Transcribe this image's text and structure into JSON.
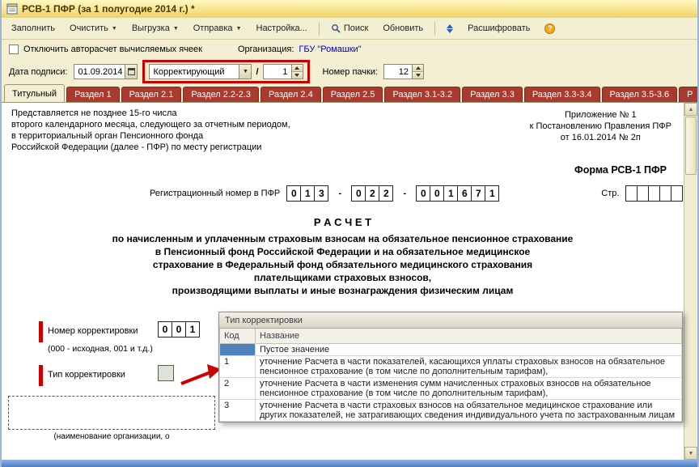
{
  "window": {
    "title": "РСВ-1 ПФР (за 1 полугодие 2014 г.) *"
  },
  "toolbar": {
    "fill": "Заполнить",
    "clear": "Очистить",
    "unload": "Выгрузка",
    "send": "Отправка",
    "settings": "Настройка...",
    "search": "Поиск",
    "refresh": "Обновить",
    "decipher": "Расшифровать",
    "help": "?"
  },
  "options_row": {
    "autocalc_label": "Отключить авторасчет вычисляемых ячеек",
    "org_label": "Организация:",
    "org_value": "ГБУ \"Ромашки\""
  },
  "date_row": {
    "date_label": "Дата подписи:",
    "date_value": "01.09.2014",
    "correction_type": "Корректирующий",
    "slash": "/",
    "correction_number": "1",
    "pack_label": "Номер пачки:",
    "pack_value": "12"
  },
  "tabs": [
    {
      "label": "Титульный"
    },
    {
      "label": "Раздел 1"
    },
    {
      "label": "Раздел 2.1"
    },
    {
      "label": "Раздел 2.2-2.3"
    },
    {
      "label": "Раздел 2.4"
    },
    {
      "label": "Раздел 2.5"
    },
    {
      "label": "Раздел 3.1-3.2"
    },
    {
      "label": "Раздел 3.3"
    },
    {
      "label": "Раздел 3.3-3.4"
    },
    {
      "label": "Раздел 3.5-3.6"
    },
    {
      "label": "Р"
    }
  ],
  "form": {
    "note_lines": [
      "Представляется не позднее 15-го числа",
      "второго календарного месяца, следующего за отчетным периодом,",
      "в территориальный орган Пенсионного фонда",
      "Российской Федерации (далее - ПФР) по месту регистрации"
    ],
    "appendix_lines": [
      "Приложение № 1",
      "к Постановлению Правления ПФР",
      "от 16.01.2014 № 2п"
    ],
    "form_name": "Форма РСВ-1 ПФР",
    "reg_label": "Регистрационный номер в ПФР",
    "reg_digits": [
      "0",
      "1",
      "3",
      "0",
      "2",
      "2",
      "0",
      "0",
      "1",
      "6",
      "7",
      "1"
    ],
    "dash": "-",
    "page_label": "Стр.",
    "calc_title": "Р А С Ч Е Т",
    "calc_lines": [
      "по начисленным и уплаченным страховым взносам на обязательное пенсионное страхование",
      "в Пенсионный фонд Российской Федерации и на обязательное медицинское",
      "страхование в Федеральный фонд обязательного медицинского страхования",
      "плательщиками страховых взносов,",
      "производящими выплаты и иные вознаграждения физическим лицам"
    ],
    "corr_number_label": "Номер корректировки",
    "corr_number_digits": [
      "0",
      "0",
      "1"
    ],
    "corr_number_hint": "(000 - исходная, 001 и т.д.)",
    "corr_type_label": "Тип корректировки",
    "org_caption": "(наименование организации, о"
  },
  "popup": {
    "title": "Тип корректировки",
    "columns": {
      "code": "Код",
      "name": "Название"
    },
    "rows": [
      {
        "code": "",
        "name": "Пустое значение"
      },
      {
        "code": "1",
        "name": "уточнение Расчета в части показателей, касающихся уплаты страховых взносов на обязательное пенсионное страхование (в том числе по дополнительным тарифам),"
      },
      {
        "code": "2",
        "name": "уточнение Расчета в части изменения сумм начисленных страховых взносов на обязательное пенсионное страхование (в том числе по дополнительным тарифам),"
      },
      {
        "code": "3",
        "name": "уточнение Расчета в части страховых взносов на обязательное медицинское страхование или других показателей, не затрагивающих сведения индивидуального учета по застрахованным лицам"
      }
    ]
  },
  "colors": {
    "annotation_red": "#CC0000",
    "link_blue": "#0000C8",
    "tab_red": "#A83A2E",
    "selection_blue": "#4F81BD"
  }
}
